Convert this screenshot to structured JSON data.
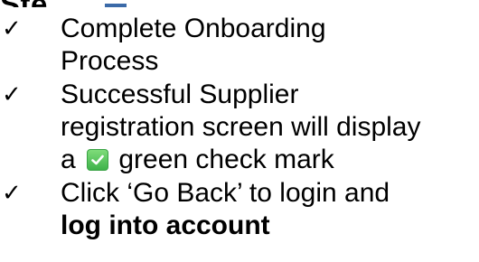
{
  "heading_fragment": "Ste",
  "items": [
    {
      "line1": "Complete Onboarding",
      "line2": "Process"
    },
    {
      "line1": "Successful Supplier",
      "line2": "registration screen will display",
      "line3_before": "a",
      "line3_after": "green check mark",
      "icon": "green-check-mark-icon"
    },
    {
      "line1": "Click ‘Go Back’ to login and",
      "line2_bold": "log into account"
    }
  ],
  "bullet_icon": "checkmark-icon",
  "colors": {
    "accent_underline": "#3b6aa8",
    "check_green": "#3eb24a",
    "text": "#000000"
  }
}
